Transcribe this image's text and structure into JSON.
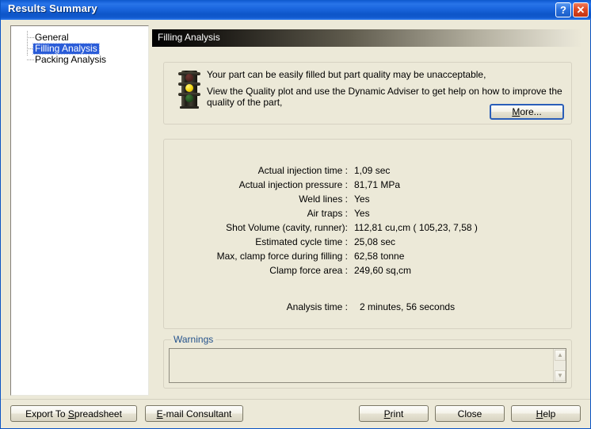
{
  "window": {
    "title": "Results Summary",
    "help_button": "?",
    "close_button": "✕"
  },
  "tree": {
    "items": [
      {
        "label": "General",
        "selected": false
      },
      {
        "label": "Filling Analysis",
        "selected": true
      },
      {
        "label": "Packing Analysis",
        "selected": false
      }
    ]
  },
  "section": {
    "header": "Filling Analysis"
  },
  "message": {
    "icon": "traffic-light-icon",
    "lit_lamp": "amber",
    "line1": "Your part can be easily filled but part quality may be unacceptable,",
    "line2": " View the Quality plot and use the Dynamic Adviser to get help on how to improve the quality of the part,",
    "more_button": "More..."
  },
  "results": {
    "rows": [
      {
        "label": "Actual injection time :",
        "value": "1,09 sec"
      },
      {
        "label": "Actual injection pressure :",
        "value": "81,71 MPa"
      },
      {
        "label": "Weld lines :",
        "value": "Yes"
      },
      {
        "label": "Air traps :",
        "value": "Yes"
      },
      {
        "label": "Shot Volume (cavity, runner):",
        "value": "112,81 cu,cm ( 105,23, 7,58 )"
      },
      {
        "label": "Estimated cycle time :",
        "value": "25,08 sec"
      },
      {
        "label": "Max, clamp force during filling :",
        "value": "62,58 tonne"
      },
      {
        "label": "Clamp force area :",
        "value": "249,60 sq,cm"
      }
    ],
    "analysis_time_label": "Analysis time :",
    "analysis_time_value": "2 minutes, 56 seconds"
  },
  "warnings": {
    "legend": "Warnings",
    "text": "",
    "scroll_up": "▲",
    "scroll_down": "▼"
  },
  "buttons": {
    "export": "Export To Spreadsheet",
    "email": "E-mail Consultant",
    "print": "Print",
    "close": "Close",
    "help": "Help"
  },
  "colors": {
    "titlebar_blue": "#1763DB",
    "panel_beige": "#ECE9D8",
    "selection_blue": "#2A5CD8",
    "legend_blue": "#24528C",
    "traffic_amber": "#F2D40E"
  }
}
